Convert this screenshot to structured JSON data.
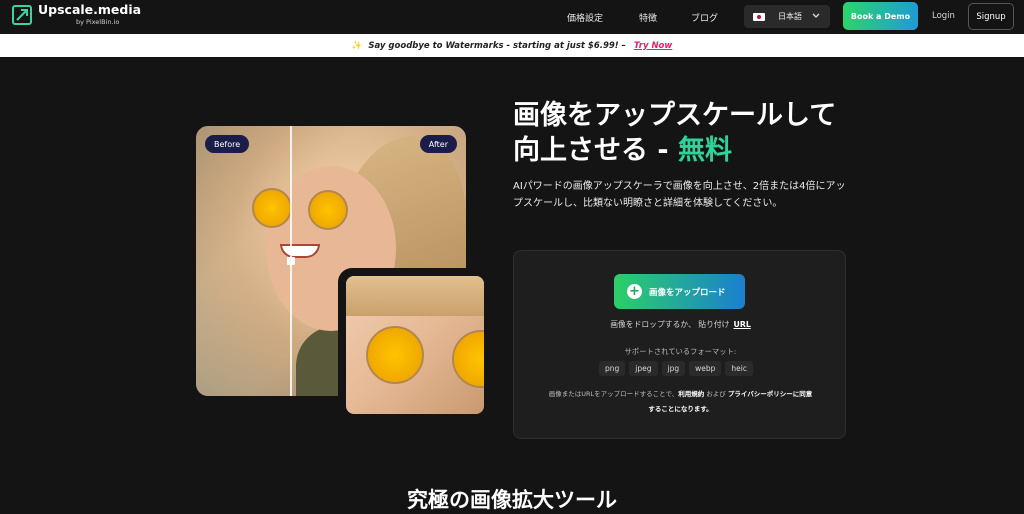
{
  "header": {
    "logo_title": "Upscale.media",
    "logo_sub": "by PixelBin.io",
    "nav": [
      "価格設定",
      "特徴",
      "ブログ"
    ],
    "language": "日本語",
    "demo_label": "Book a Demo",
    "login_label": "Login",
    "signup_label": "Signup"
  },
  "banner": {
    "text": "Say goodbye to Watermarks - starting at just $6.99! –",
    "cta": "Try Now"
  },
  "hero": {
    "before_label": "Before",
    "after_label": "After",
    "title_line1": "画像をアップスケールして",
    "title_line2": "向上させる - ",
    "title_free": "無料",
    "description": "AIパワードの画像アップスケーラで画像を向上させ、2倍または4倍にアップスケールし、比類ない明瞭さと詳細を体験してください。"
  },
  "upload": {
    "button_label": "画像をアップロード",
    "drop_text": "画像をドロップするか、 貼り付け",
    "url_label": "URL",
    "formats_label": "サポートされているフォーマット:",
    "formats": [
      "png",
      "jpeg",
      "jpg",
      "webp",
      "heic"
    ],
    "terms_prefix": "画像またはURLをアップロードすることで、",
    "terms_link": "利用規約",
    "terms_and": " および ",
    "privacy_link": "プライバシーポリシーに同意",
    "terms_suffix": "することになります。"
  },
  "section": {
    "title": "究極の画像拡大ツール"
  },
  "colors": {
    "accent_green": "#2ed39a",
    "cta_pink": "#e0216b",
    "background": "#141414"
  }
}
